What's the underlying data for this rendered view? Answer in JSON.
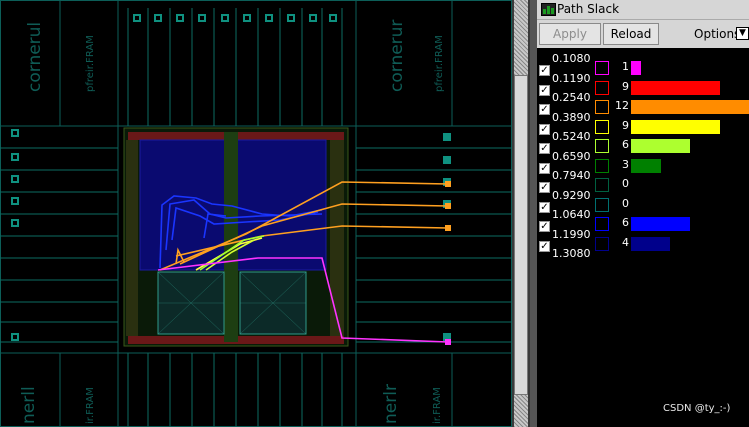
{
  "layout": {
    "corner_labels": {
      "top_left": "cornerul",
      "top_left_fram": "pfreir.FRAM",
      "top_right": "cornerur",
      "top_right_fram": "pfreir.FRAM",
      "bottom_left": "nerll",
      "bottom_left_fram": "ir.FRAM",
      "bottom_right": "nerlr",
      "bottom_right_fram": "ir.FRAM"
    },
    "colors": {
      "magenta": "#ff33ff",
      "orange": "#ffa020",
      "yellow": "#ffff40",
      "green": "#a0ff30",
      "blue": "#1a35ff",
      "pad_teal": "#0c6b62",
      "macro_red": "#c0282c"
    }
  },
  "panel": {
    "title": "Path Slack",
    "title_icon": "histogram-icon",
    "apply_label": "Apply",
    "reload_label": "Reload",
    "options_label": "Options:",
    "options_glyph": "▼",
    "check_glyph": "✓",
    "thresholds": [
      "0.1080",
      "0.1190",
      "0.2540",
      "0.3890",
      "0.5240",
      "0.6590",
      "0.7940",
      "0.9290",
      "1.0640",
      "1.1990",
      "1.3080"
    ],
    "bins": [
      {
        "count": 1,
        "color": "#ff00ff"
      },
      {
        "count": 9,
        "color": "#ff0000"
      },
      {
        "count": 12,
        "color": "#ff8c00"
      },
      {
        "count": 9,
        "color": "#ffff00"
      },
      {
        "count": 6,
        "color": "#adff2f"
      },
      {
        "count": 3,
        "color": "#008000"
      },
      {
        "count": 0,
        "color": "#006040"
      },
      {
        "count": 0,
        "color": "#007070"
      },
      {
        "count": 6,
        "color": "#0000ff"
      },
      {
        "count": 4,
        "color": "#00008b"
      }
    ]
  },
  "watermark": "CSDN @ty_:-)"
}
